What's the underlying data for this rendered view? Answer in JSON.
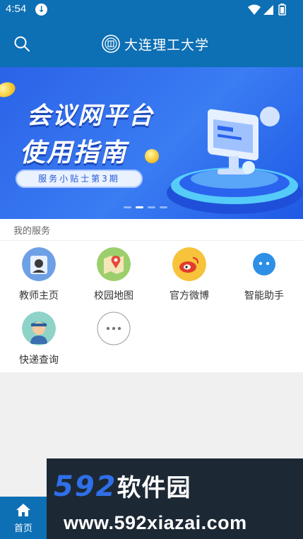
{
  "status_bar": {
    "time": "4:54"
  },
  "app_bar": {
    "school_name": "大连理工大学"
  },
  "banner": {
    "headline_1": "会议网平台",
    "headline_2": "使用指南",
    "tag": "服务小贴士第3期",
    "page_count": 4,
    "active_page": 2
  },
  "services": {
    "section_title": "我的服务",
    "items": [
      {
        "label": "教师主页",
        "icon": "teacher-icon"
      },
      {
        "label": "校园地图",
        "icon": "map-icon"
      },
      {
        "label": "官方微博",
        "icon": "weibo-icon"
      },
      {
        "label": "智能助手",
        "icon": "assistant-icon"
      },
      {
        "label": "快递查询",
        "icon": "courier-icon"
      },
      {
        "label": "",
        "icon": "more-icon"
      }
    ]
  },
  "tab_bar": {
    "home_label": "首页"
  },
  "watermark": {
    "line1_digits": "592",
    "line1_cn": "软件园",
    "line2": "www.592xiazai.com"
  },
  "colors": {
    "primary": "#0d6fb4",
    "banner": "#2b63e8"
  }
}
